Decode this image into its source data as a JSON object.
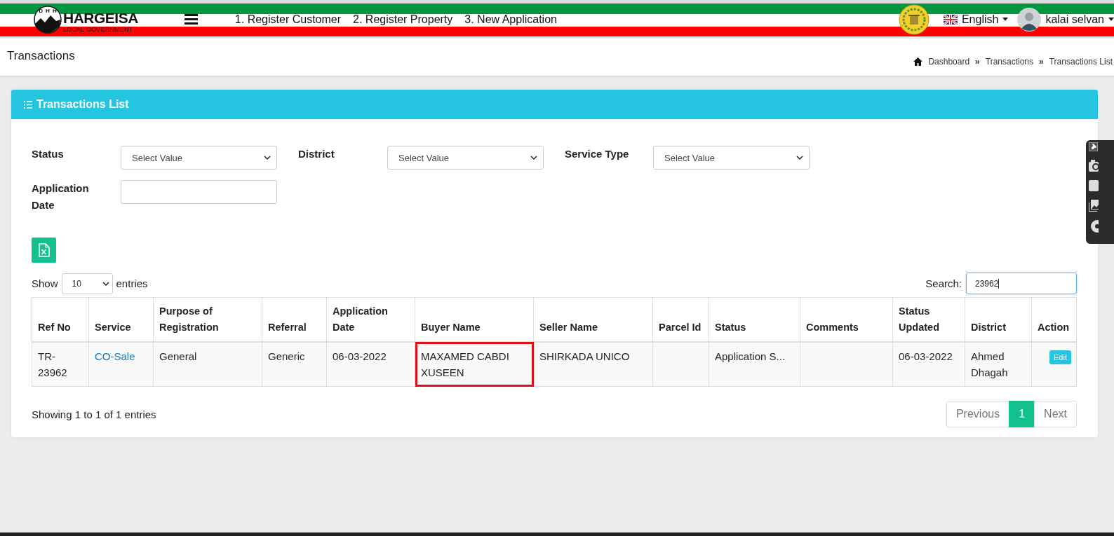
{
  "header": {
    "logo_letters": "DHH",
    "brand": "HARGEISA",
    "brand_sub": "LOCAL GOVERNMENT",
    "nav": [
      "1. Register Customer",
      "2. Register Property",
      "3. New Application"
    ],
    "language": "English",
    "user": "kalai selvan"
  },
  "page": {
    "title": "Transactions",
    "breadcrumb": [
      "Dashboard",
      "Transactions",
      "Transactions List"
    ],
    "separator": "»"
  },
  "card": {
    "title": "Transactions List"
  },
  "filters": [
    {
      "label": "Status",
      "kind": "select",
      "value": "Select Value"
    },
    {
      "label": "District",
      "kind": "select",
      "value": "Select Value"
    },
    {
      "label": "Service Type",
      "kind": "select",
      "value": "Select Value"
    },
    {
      "label": "Application Date",
      "kind": "date"
    }
  ],
  "length": {
    "show": "Show",
    "value": "10",
    "entries": "entries"
  },
  "search": {
    "label": "Search:",
    "value": "23962"
  },
  "table": {
    "columns": [
      "Ref No",
      "Service",
      "Purpose of Registration",
      "Referral",
      "Application Date",
      "Buyer Name",
      "Seller Name",
      "Parcel Id",
      "Status",
      "Comments",
      "Status Updated",
      "District",
      "Action"
    ],
    "rows": [
      {
        "cells": [
          {
            "text": "TR-23962",
            "kind": "plain"
          },
          {
            "text": "CO-Sale",
            "kind": "link"
          },
          {
            "text": "General",
            "kind": "plain"
          },
          {
            "text": "Generic",
            "kind": "plain"
          },
          {
            "text": "06-03-2022",
            "kind": "plain"
          },
          {
            "text": "MAXAMED CABDI XUSEEN",
            "kind": "highlighted"
          },
          {
            "text": "SHIRKADA UNICO",
            "kind": "plain"
          },
          {
            "kind": "empty"
          },
          {
            "text": "Application S...",
            "kind": "plain"
          },
          {
            "kind": "empty"
          },
          {
            "text": "06-03-2022",
            "kind": "plain"
          },
          {
            "text": "Ahmed Dhagah",
            "kind": "plain"
          },
          {
            "text": "Edit",
            "kind": "button"
          }
        ]
      }
    ]
  },
  "info": "Showing 1 to 1 of 1 entries",
  "pagination": [
    {
      "label": "Previous",
      "selected": false,
      "disabled": true
    },
    {
      "label": "1",
      "selected": true,
      "disabled": false
    },
    {
      "label": "Next",
      "selected": false,
      "disabled": true
    }
  ]
}
